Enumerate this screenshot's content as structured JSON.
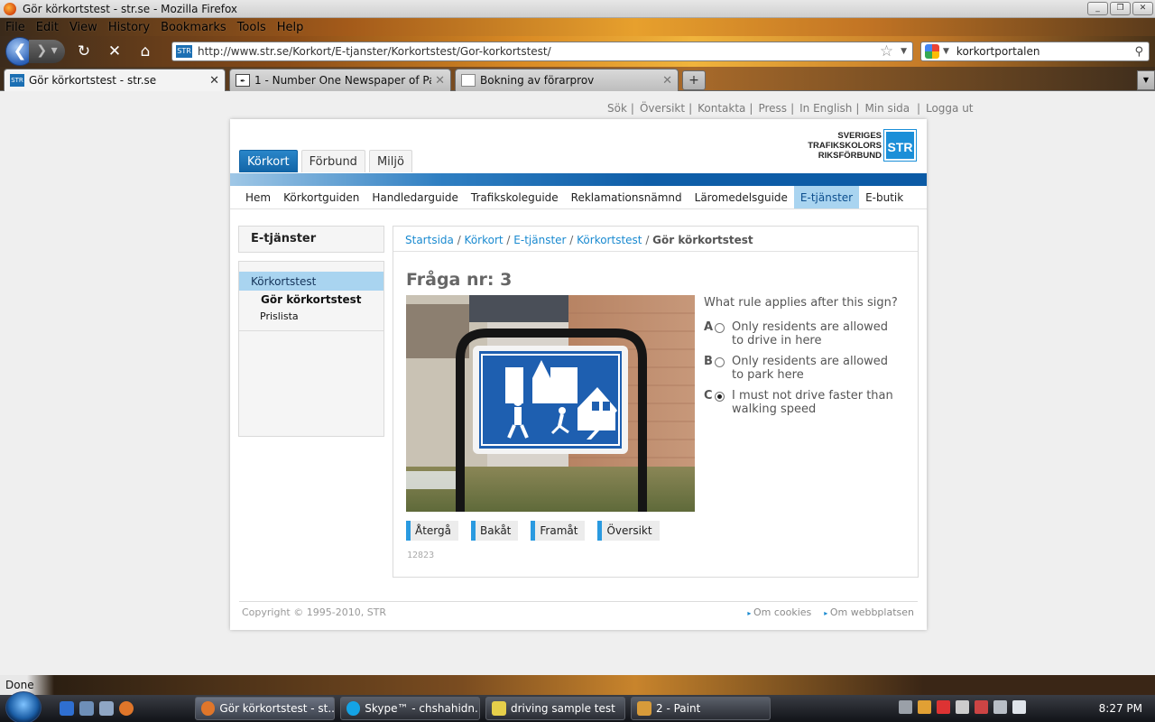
{
  "window": {
    "title": "Gör körkortstest - str.se - Mozilla Firefox",
    "buttons": [
      "_",
      "❐",
      "✕"
    ]
  },
  "menubar": [
    "File",
    "Edit",
    "View",
    "History",
    "Bookmarks",
    "Tools",
    "Help"
  ],
  "navbar": {
    "url": "http://www.str.se/Korkort/E-tjanster/Korkortstest/Gor-korkortstest/",
    "url_favicon": "STR",
    "search_query": "korkortportalen"
  },
  "tabs": [
    {
      "label": "Gör körkortstest - str.se",
      "favicon": "STR",
      "active": true
    },
    {
      "label": "1 - Number One Newspaper of Paki...",
      "favicon": "",
      "active": false
    },
    {
      "label": "Bokning av förarprov",
      "favicon": "",
      "active": false
    }
  ],
  "page": {
    "toplinks": [
      "Sök",
      "Översikt",
      "Kontakta",
      "Press",
      "In English",
      "Min sida",
      "Logga ut"
    ],
    "logo": {
      "lines": [
        "SVERIGES",
        "TRAFIKSKOLORS",
        "RIKSFÖRBUND"
      ],
      "mark": "STR"
    },
    "main_tabs": [
      "Körkort",
      "Förbund",
      "Miljö"
    ],
    "subnav": [
      "Hem",
      "Körkortguiden",
      "Handledarguide",
      "Trafikskoleguide",
      "Reklamationsnämnd",
      "Läromedelsguide",
      "E-tjänster",
      "E-butik"
    ],
    "sidebar": {
      "title": "E-tjänster",
      "selected": "Körkortstest",
      "items": [
        "Gör körkortstest",
        "Prislista"
      ]
    },
    "breadcrumb": {
      "links": [
        "Startsida",
        "Körkort",
        "E-tjänster",
        "Körkortstest"
      ],
      "current": "Gör körkortstest"
    },
    "question_title": "Fråga nr: 3",
    "question_text": "What rule applies after this sign?",
    "options": [
      {
        "letter": "A",
        "text": "Only residents are allowed to drive in here",
        "selected": false
      },
      {
        "letter": "B",
        "text": "Only residents are allowed to park here",
        "selected": false
      },
      {
        "letter": "C",
        "text": "I must not drive faster than walking speed",
        "selected": true
      }
    ],
    "buttons": [
      "Återgå",
      "Bakåt",
      "Framåt",
      "Översikt"
    ],
    "page_id": "12823",
    "footer": {
      "copyright": "Copyright © 1995-2010, STR",
      "links": [
        "Om cookies",
        "Om webbplatsen"
      ]
    }
  },
  "statusbar": {
    "text": "Done"
  },
  "taskbar": {
    "tasks": [
      "Gör körkortstest - st...",
      "Skype™ - chshahidn...",
      "driving sample test",
      "2 - Paint"
    ],
    "clock": "8:27 PM"
  },
  "colors": {
    "accent": "#1b8fd8",
    "nav_blue": "#1164a6",
    "highlight": "#a9d4f0"
  }
}
